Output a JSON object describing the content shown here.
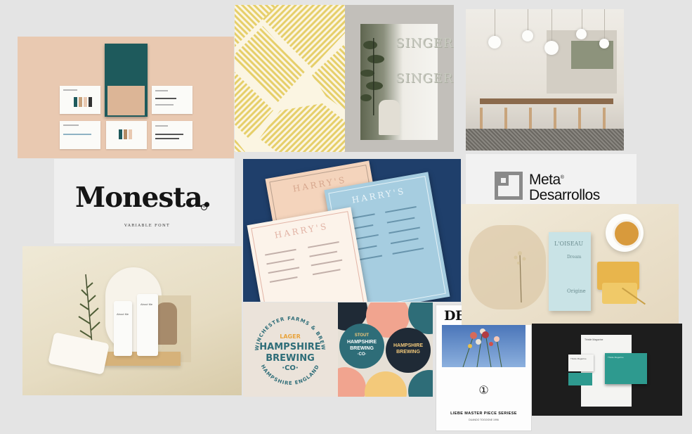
{
  "tiles": {
    "monesta": {
      "title": "Monesta.",
      "subtitle": "VARIABLE FONT",
      "mark": "®"
    },
    "meta": {
      "line1": "Meta",
      "line2": "Desarrollos",
      "mark": "®"
    },
    "singer": {
      "word1": "SINGER",
      "word2": "SINGER"
    },
    "harrys": {
      "menu_title": "HARRY'S"
    },
    "hampshire": {
      "ring_top": "WINCHESTER FARMS & BREW",
      "ring_bottom": "HAMPSHIRE ENGLAND",
      "badge_label": "LAGER",
      "line1": "HAMPSHIRE",
      "line2": "BREWING",
      "line3": "·CO·",
      "badge2_label": "STOUT"
    },
    "desolate": {
      "title": "DESOLATE",
      "number_glyph": "①",
      "subtitle": "LIEBE MASTER PIECE SERIESE",
      "small": "DUANDO TOGOGNE 1996"
    },
    "oiseau": {
      "brand": "L'OISEAU",
      "product": "Origine",
      "text": "Dream"
    },
    "skincare": {
      "brand": "About Me"
    },
    "stationery": {
      "brand": "Thistle Magazine"
    }
  },
  "colors": {
    "background": "#e4e4e4",
    "peach": "#e9c9b1",
    "teal": "#1e5a5c",
    "navy": "#1f3f6b",
    "pattern_yellow": "#e6cf6a",
    "hampshire_teal": "#2e6d78",
    "hampshire_orange": "#e9a33b",
    "stationery_green": "#2e9a8f"
  }
}
